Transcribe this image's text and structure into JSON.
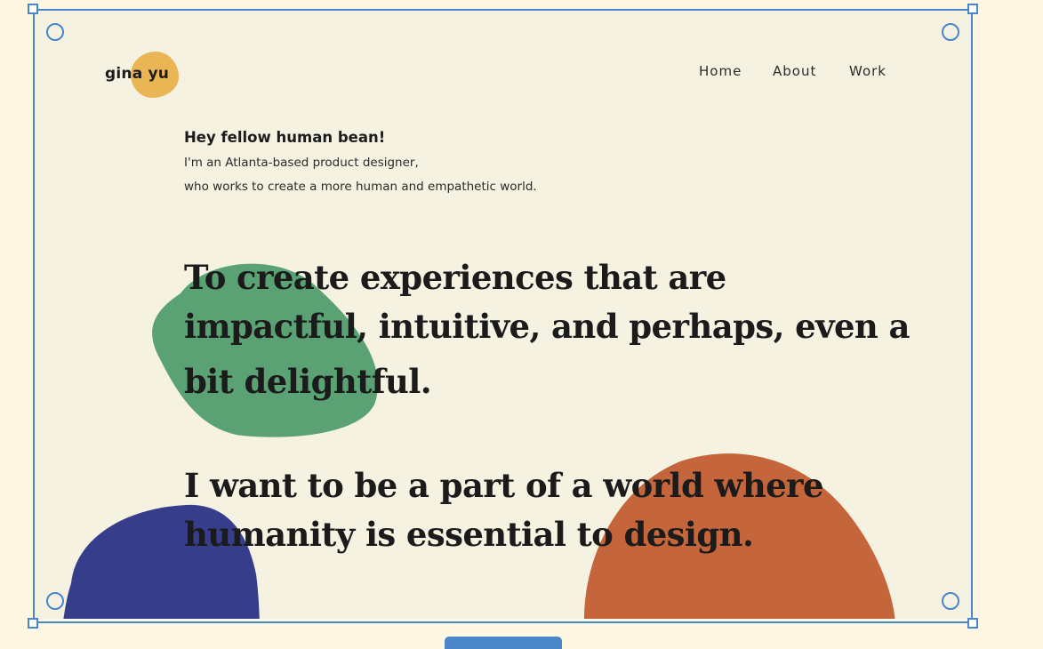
{
  "site": {
    "logo": "gina yu",
    "nav": [
      "Home",
      "About",
      "Work"
    ]
  },
  "hero": {
    "greeting": "Hey fellow human bean!",
    "intro_line1": "I'm an Atlanta-based product designer,",
    "intro_line2": "who works to create a more human and empathetic world.",
    "statement1_lines": [
      "To create experiences that are",
      "impactful, intuitive, and perhaps, even a",
      "bit delightful."
    ],
    "statement2_lines": [
      "I want to be a part of a world where",
      "humanity is essential to design."
    ]
  },
  "colors": {
    "page_bg": "#f6f2e2",
    "outer_bg": "#fdf7e3",
    "selection": "#4a86c8",
    "logo_blob": "#eab554",
    "green_blob": "#5aa274",
    "blue_blob": "#363d8a",
    "orange_blob": "#c4653b"
  }
}
